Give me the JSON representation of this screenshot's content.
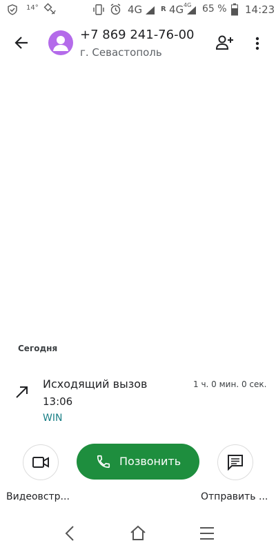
{
  "status_bar": {
    "temperature": "14°",
    "net1": "4G",
    "roam": "R",
    "net2": "4G",
    "net2_sup": "4G",
    "battery": "65 %",
    "time": "14:23"
  },
  "header": {
    "phone": "+7 869 241-76-00",
    "location": "г. Севастополь"
  },
  "log": {
    "section": "Сегодня",
    "entries": [
      {
        "type": "Исходящий вызов",
        "time": "13:06",
        "sim": "WIN",
        "duration": "1 ч. 0 мин. 0 сек."
      }
    ]
  },
  "actions": {
    "video_label": "Видеовстр...",
    "call_label": "Позвонить",
    "send_label": "Отправить ..."
  },
  "colors": {
    "avatar": "#b46bea",
    "call_button": "#1e8e3e",
    "sim_text": "#1a7f86"
  },
  "icons": [
    "back-arrow-icon",
    "person-icon",
    "add-person-icon",
    "more-vert-icon",
    "outgoing-call-icon",
    "videocam-icon",
    "phone-icon",
    "message-icon",
    "nav-back-icon",
    "nav-home-icon",
    "nav-recents-icon"
  ]
}
